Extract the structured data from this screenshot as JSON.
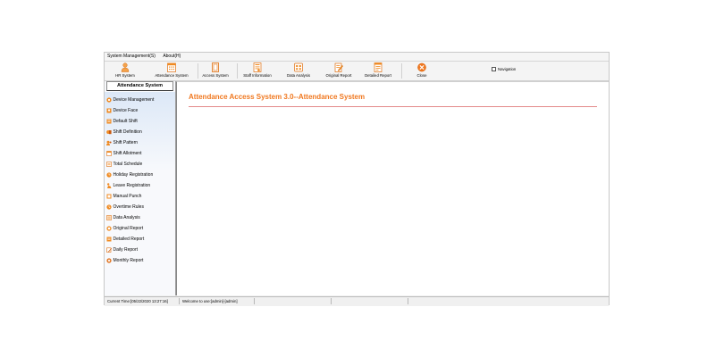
{
  "menu": {
    "items": [
      "System Management(S)",
      "About(H)"
    ]
  },
  "toolbar": {
    "buttons": [
      {
        "label": "HR System",
        "icon": "person-icon"
      },
      {
        "label": "Attendance System",
        "icon": "calendar-icon"
      },
      {
        "label": "Access System",
        "icon": "door-icon"
      },
      {
        "label": "Staff Information",
        "icon": "staff-card-icon"
      },
      {
        "label": "Data Analysis",
        "icon": "data-analysis-icon"
      },
      {
        "label": "Original Report",
        "icon": "pencil-report-icon"
      },
      {
        "label": "Detailed Report",
        "icon": "detailed-report-icon"
      },
      {
        "label": "Close",
        "icon": "close-icon"
      }
    ],
    "navigation_label": "Navigation",
    "navigation_checked": false
  },
  "sidebar": {
    "title": "Attendance System",
    "items": [
      {
        "label": "Device Management",
        "icon": "device-icon"
      },
      {
        "label": "Device Face",
        "icon": "face-icon"
      },
      {
        "label": "Default Shift",
        "icon": "shift-icon"
      },
      {
        "label": "Shift Definition",
        "icon": "shift-definition-icon"
      },
      {
        "label": "Shift Pattern",
        "icon": "shift-pattern-icon"
      },
      {
        "label": "Shift Allotment",
        "icon": "shift-allotment-icon"
      },
      {
        "label": "Total Schedule",
        "icon": "schedule-icon"
      },
      {
        "label": "Holiday Registration",
        "icon": "holiday-icon"
      },
      {
        "label": "Leave Registration",
        "icon": "leave-icon"
      },
      {
        "label": "Manual Punch",
        "icon": "manual-punch-icon"
      },
      {
        "label": "Overtime Rules",
        "icon": "overtime-icon"
      },
      {
        "label": "Data Analysis",
        "icon": "data-analysis-icon"
      },
      {
        "label": "Original Report",
        "icon": "original-report-icon"
      },
      {
        "label": "Detailed Report",
        "icon": "detailed-report-icon"
      },
      {
        "label": "Daily Report",
        "icon": "daily-report-icon"
      },
      {
        "label": "Monthly Report",
        "icon": "monthly-report-icon"
      }
    ]
  },
  "main": {
    "title": "Attendance Access System 3.0--Attendance System"
  },
  "status": {
    "time": "Current Time:[05/22/2020 13:27:16]",
    "welcome": "Welcome to use:[admin]-[admin]"
  },
  "colors": {
    "accent": "#f07820",
    "rule": "#e38a8a"
  }
}
